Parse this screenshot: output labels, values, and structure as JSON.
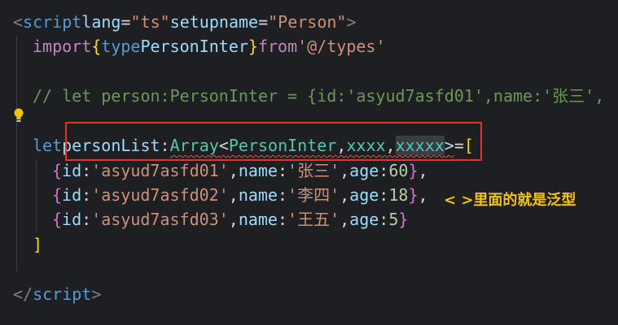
{
  "code": {
    "l1": {
      "lt": "<",
      "tag": "script",
      "a1": "lang",
      "eq1": "=",
      "v1": "\"ts\"",
      "a2": "setup",
      "a3": "name",
      "eq3": "=",
      "v3": "\"Person\"",
      "gt": ">"
    },
    "l2": {
      "kw": "import",
      "ob": "{",
      "type_kw": "type",
      "name": "PersonInter",
      "cb": "}",
      "from": "from",
      "path": "'@/types'"
    },
    "l4": {
      "comment": "// let person:PersonInter = {id:'asyud7asfd01',name:'张三',"
    },
    "l6": {
      "let": "let",
      "var": "personList",
      "colon": ":",
      "arr": "Array",
      "lt": "<",
      "t1": "PersonInter",
      "c1": ",",
      "t2": "xxxx",
      "c2": ",",
      "t3": "xxxxx",
      "gt": ">",
      "eq": "=",
      "ob": "["
    },
    "rows": [
      {
        "ob": "{",
        "k1": "id",
        "c1": ":",
        "v1": "'asyud7asfd01'",
        "s1": ",",
        "k2": "name",
        "c2": ":",
        "v2": "'张三'",
        "s2": ",",
        "k3": "age",
        "c3": ":",
        "v3": "60",
        "cb": "}",
        "tail": ","
      },
      {
        "ob": "{",
        "k1": "id",
        "c1": ":",
        "v1": "'asyud7asfd02'",
        "s1": ",",
        "k2": "name",
        "c2": ":",
        "v2": "'李四'",
        "s2": ",",
        "k3": "age",
        "c3": ":",
        "v3": "18",
        "cb": "}",
        "tail": ","
      },
      {
        "ob": "{",
        "k1": "id",
        "c1": ":",
        "v1": "'asyud7asfd03'",
        "s1": ",",
        "k2": "name",
        "c2": ":",
        "v2": "'王五'",
        "s2": ",",
        "k3": "age",
        "c3": ":",
        "v3": "5",
        "cb": "}",
        "tail": ""
      }
    ],
    "l10": {
      "cb": "]"
    },
    "l12": {
      "lt": "</",
      "tag": "script",
      "gt": ">"
    }
  },
  "annotation": {
    "text": "< >里面的就是泛型"
  },
  "colors": {
    "highlight_box": "#e8332b",
    "annotation": "#f5c400"
  },
  "icons": {
    "lightbulb": "lightbulb-icon"
  }
}
